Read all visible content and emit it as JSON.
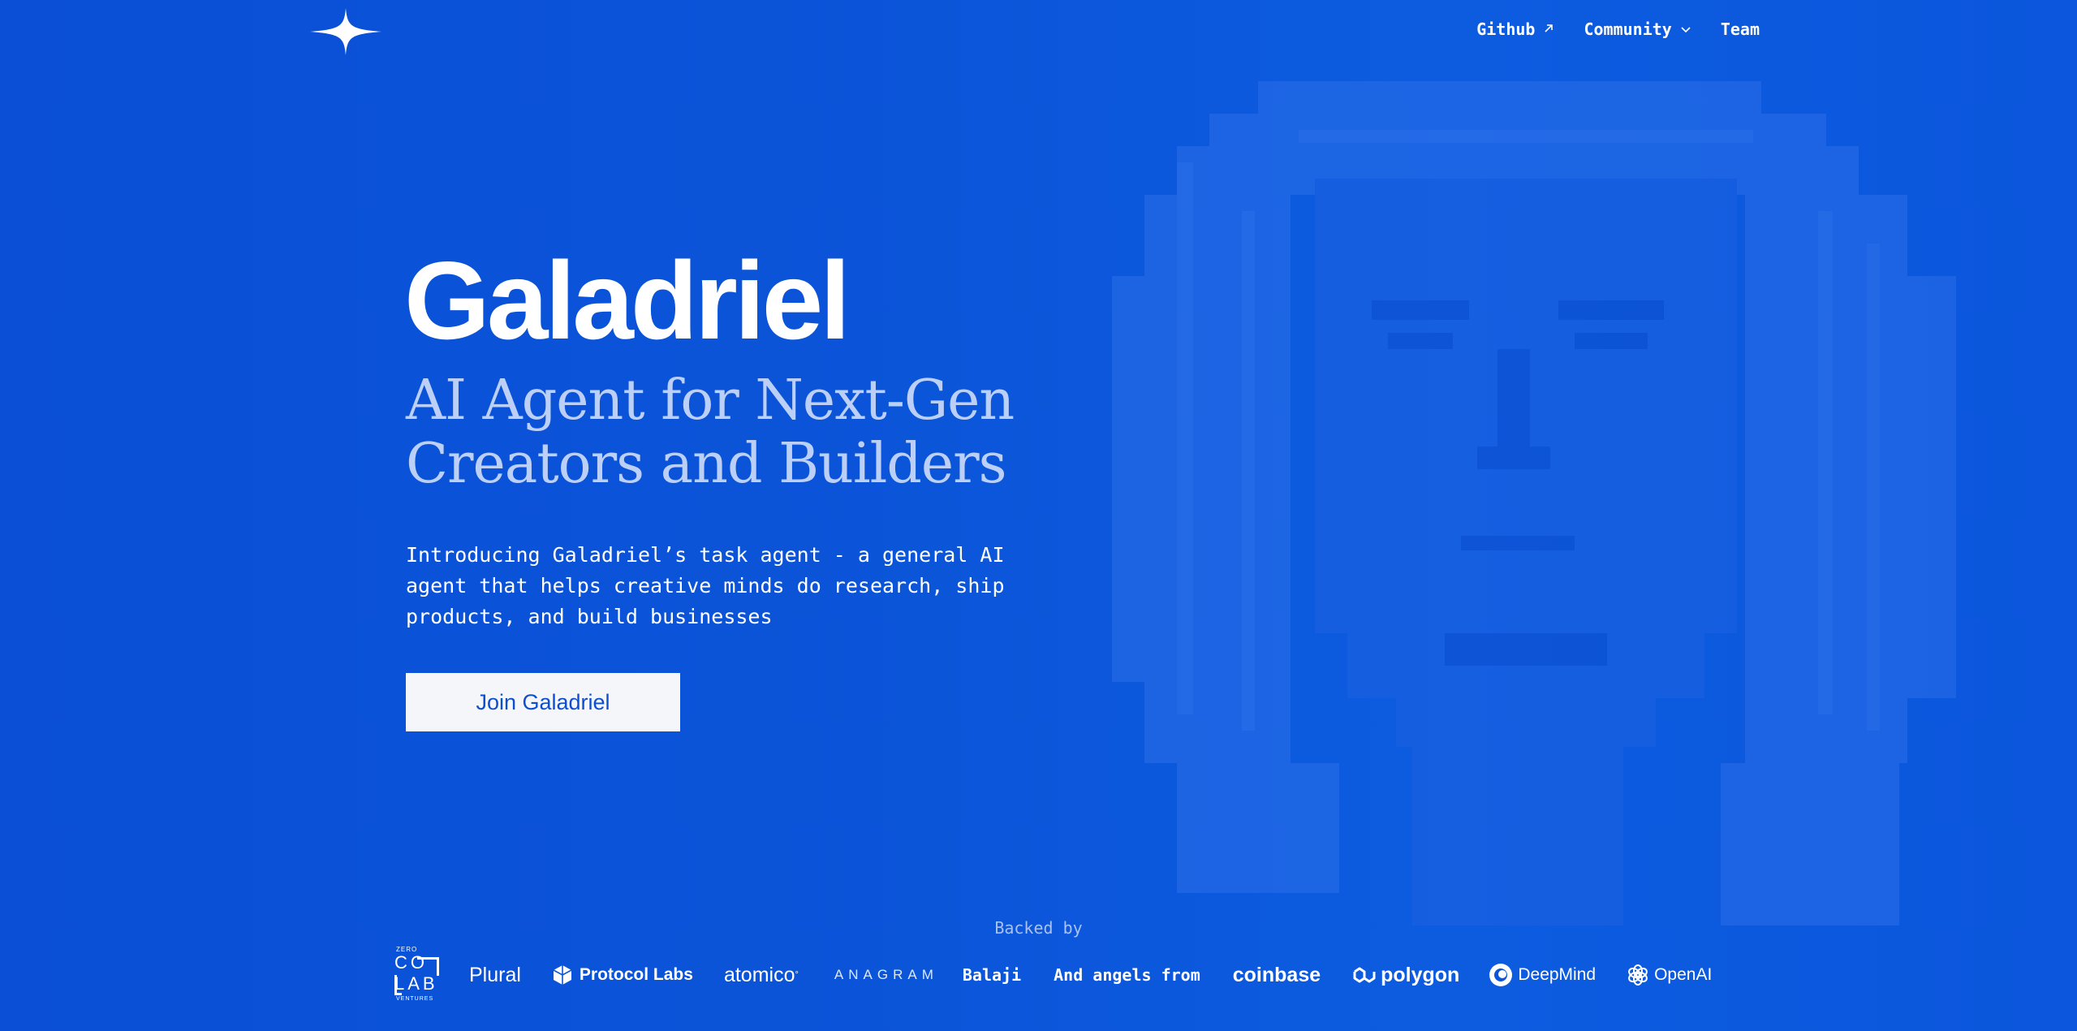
{
  "nav": {
    "items": [
      {
        "label": "Github",
        "icon": "arrow-up-right-icon"
      },
      {
        "label": "Community",
        "icon": "chevron-down-icon"
      },
      {
        "label": "Team"
      }
    ]
  },
  "hero": {
    "brand": "Galadriel",
    "tagline_line1": "AI Agent for Next-Gen",
    "tagline_line2": "Creators and Builders",
    "intro": "Introducing Galadriel’s task agent - a general AI agent that helps creative minds do research, ship products, and build businesses",
    "cta_label": "Join Galadriel"
  },
  "backers": {
    "label": "Backed by",
    "colab": {
      "top": "ZERO",
      "co": "CO",
      "lab": "LAB",
      "bottom": "VENTURES"
    },
    "plural": "Plural",
    "protocol_labs": "Protocol Labs",
    "atomico": "atomico",
    "atomico_mark": "°",
    "anagram": "ANAGRAM",
    "balaji": "Balaji",
    "angels": "And angels from",
    "coinbase": "coinbase",
    "polygon": "polygon",
    "deepmind": "DeepMind",
    "openai": "OpenAI"
  },
  "colors": {
    "background": "#0b55d9",
    "tagline": "#bcd0f7",
    "cta_background": "#f4f6fa",
    "cta_text": "#0b4fcf"
  }
}
